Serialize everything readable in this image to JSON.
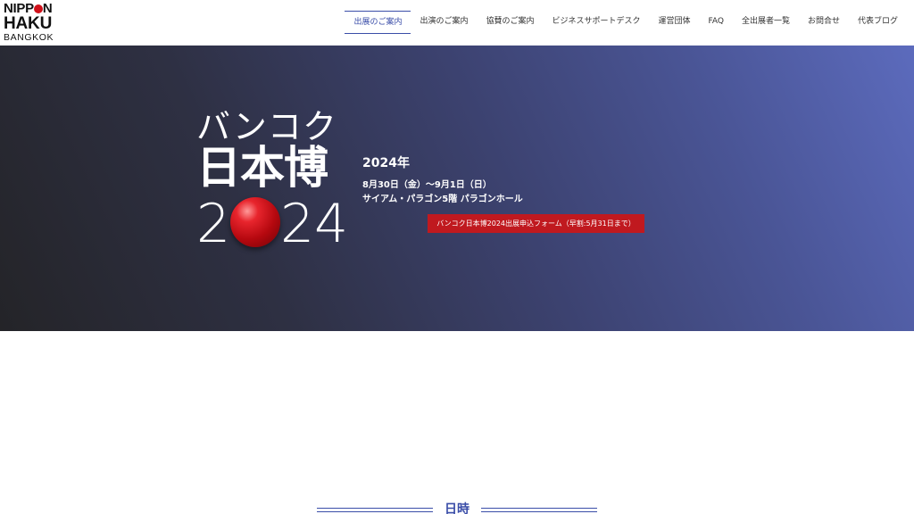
{
  "logo": {
    "line1_a": "NIPP",
    "line1_b": "N",
    "line2": "HAKU",
    "line3": "BANGKOK"
  },
  "nav": {
    "items": [
      {
        "label": "出展のご案内",
        "active": true
      },
      {
        "label": "出演のご案内",
        "active": false
      },
      {
        "label": "協賛のご案内",
        "active": false
      },
      {
        "label": "ビジネスサポートデスク",
        "active": false
      },
      {
        "label": "運営団体",
        "active": false
      },
      {
        "label": "FAQ",
        "active": false
      },
      {
        "label": "全出展者一覧",
        "active": false
      },
      {
        "label": "お問合せ",
        "active": false
      },
      {
        "label": "代表ブログ",
        "active": false
      }
    ]
  },
  "hero": {
    "logo_kana": "バンコク",
    "logo_kanji": "日本博",
    "logo_year_d1": "2",
    "logo_year_d3": "2",
    "logo_year_d4": "4",
    "event_year": "2024年",
    "event_date": "8月30日（金）〜9月1日（日）",
    "event_venue": "サイアム・パラゴン5階 パラゴンホール",
    "cta_label": "バンコク日本博2024出展申込フォーム（早割:5月31日まで）",
    "accent_color": "#c0191f"
  },
  "section": {
    "title": "日時"
  }
}
